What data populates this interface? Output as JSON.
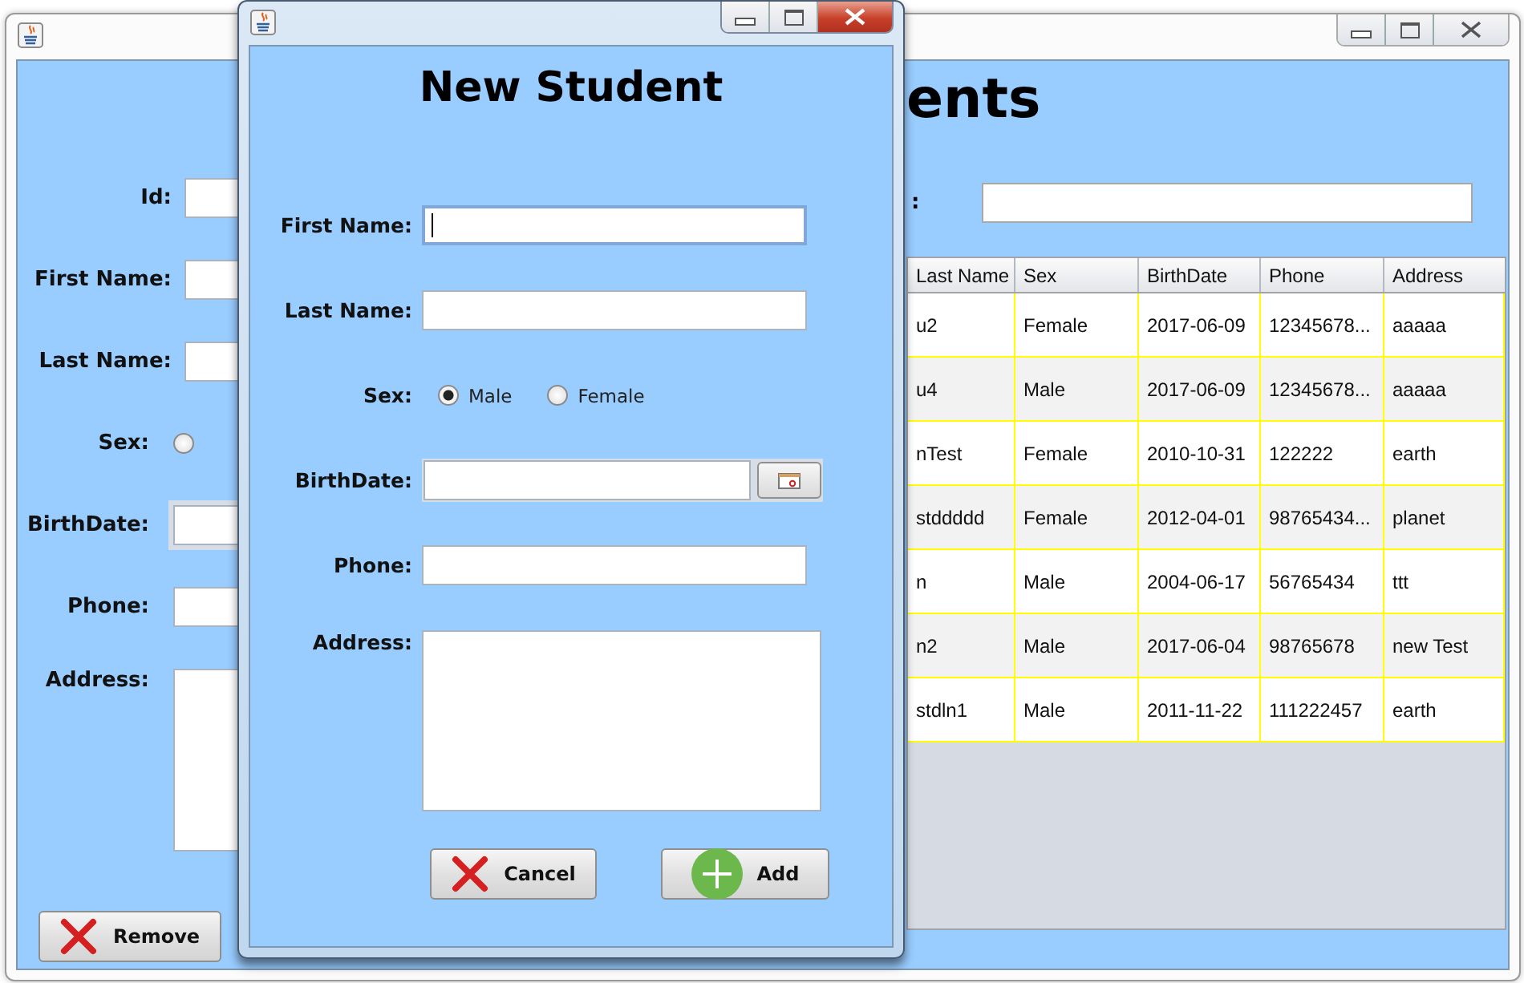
{
  "main_window": {
    "title": "ents",
    "fields": [
      {
        "label": "Id:",
        "kind": "text"
      },
      {
        "label": "First Name:",
        "kind": "text"
      },
      {
        "label": "Last Name:",
        "kind": "text"
      },
      {
        "label": "Sex:",
        "kind": "radio",
        "options": [
          {
            "selected": false
          }
        ]
      },
      {
        "label": "BirthDate:",
        "kind": "date"
      },
      {
        "label": "Phone:",
        "kind": "text"
      },
      {
        "label": "Address:",
        "kind": "textarea"
      }
    ],
    "search_label": ":",
    "table": {
      "columns": [
        "Last Name",
        "Sex",
        "BirthDate",
        "Phone",
        "Address"
      ],
      "rows": [
        [
          "u2",
          "Female",
          "2017-06-09",
          "12345678...",
          "aaaaa"
        ],
        [
          "u4",
          "Male",
          "2017-06-09",
          "12345678...",
          "aaaaa"
        ],
        [
          "nTest",
          "Female",
          "2010-10-31",
          "122222",
          "earth"
        ],
        [
          "stddddd",
          "Female",
          "2012-04-01",
          "98765434...",
          "planet"
        ],
        [
          "n",
          "Male",
          "2004-06-17",
          "56765434",
          "ttt"
        ],
        [
          "n2",
          "Male",
          "2017-06-04",
          "98765678",
          "new Test"
        ],
        [
          "stdln1",
          "Male",
          "2011-11-22",
          "111222457",
          "earth"
        ]
      ]
    },
    "buttons": [
      {
        "label": "Remove",
        "kind": "remove"
      }
    ]
  },
  "dialog": {
    "title": "New Student",
    "fields": [
      {
        "label": "First Name:",
        "kind": "text",
        "focused": true
      },
      {
        "label": "Last Name:",
        "kind": "text",
        "focused": false
      },
      {
        "label": "Sex:",
        "kind": "radio",
        "options": [
          {
            "label": "Male",
            "selected": true
          },
          {
            "label": "Female",
            "selected": false
          }
        ]
      },
      {
        "label": "BirthDate:",
        "kind": "date",
        "focused": false
      },
      {
        "label": "Phone:",
        "kind": "text",
        "focused": false
      },
      {
        "label": "Address:",
        "kind": "textarea",
        "focused": false
      }
    ],
    "buttons": [
      {
        "label": "Cancel",
        "kind": "cancel"
      },
      {
        "label": "Add",
        "kind": "add"
      }
    ]
  }
}
